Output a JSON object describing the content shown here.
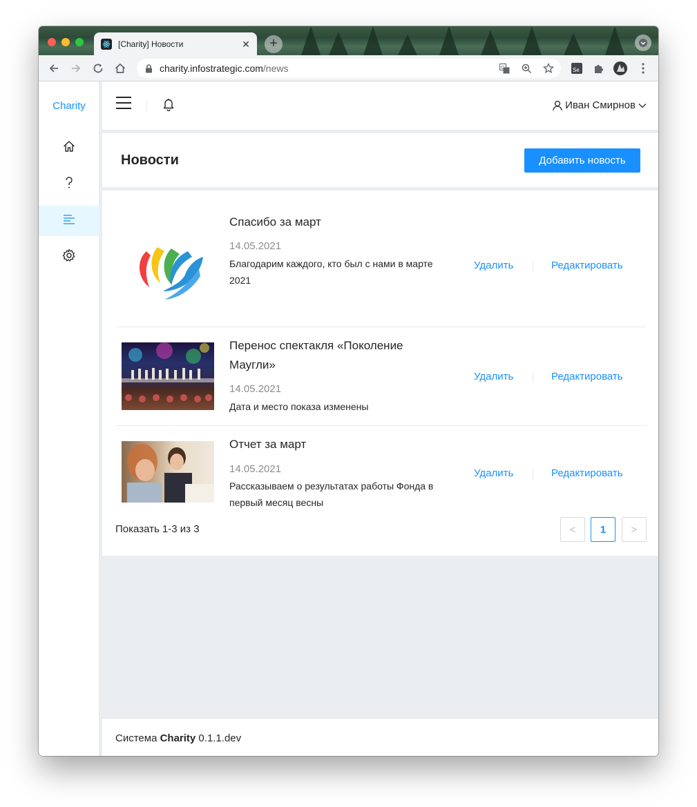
{
  "browser": {
    "tab_title": "[Charity] Новости",
    "url_host": "charity.infostrategic.com",
    "url_path": "/news"
  },
  "sidebar": {
    "brand": "Charity",
    "items": [
      {
        "icon": "home-icon",
        "active": false
      },
      {
        "icon": "question-icon",
        "active": false
      },
      {
        "icon": "news-list-icon",
        "active": true
      },
      {
        "icon": "settings-gear-icon",
        "active": false
      }
    ]
  },
  "header": {
    "user_name": "Иван Смирнов"
  },
  "page": {
    "title": "Новости",
    "add_button": "Добавить новость"
  },
  "news": [
    {
      "title": "Спасибо за март",
      "date": "14.05.2021",
      "description": "Благодарим каждого, кто был с нами в марте 2021",
      "delete": "Удалить",
      "edit": "Редактировать"
    },
    {
      "title": "Перенос спектакля «Поколение Маугли»",
      "date": "14.05.2021",
      "description": "Дата и место показа изменены",
      "delete": "Удалить",
      "edit": "Редактировать"
    },
    {
      "title": "Отчет за март",
      "date": "14.05.2021",
      "description": "Рассказываем о результатах работы Фонда в первый месяц весны",
      "delete": "Удалить",
      "edit": "Редактировать"
    }
  ],
  "pagination": {
    "total_text": "Показать 1-3 из 3",
    "prev": "<",
    "current": "1",
    "next": ">"
  },
  "footer": {
    "prefix": "Система ",
    "brand": "Charity",
    "version": " 0.1.1.dev"
  },
  "colors": {
    "primary": "#1890ff",
    "layout_bg": "#ebeef1"
  }
}
